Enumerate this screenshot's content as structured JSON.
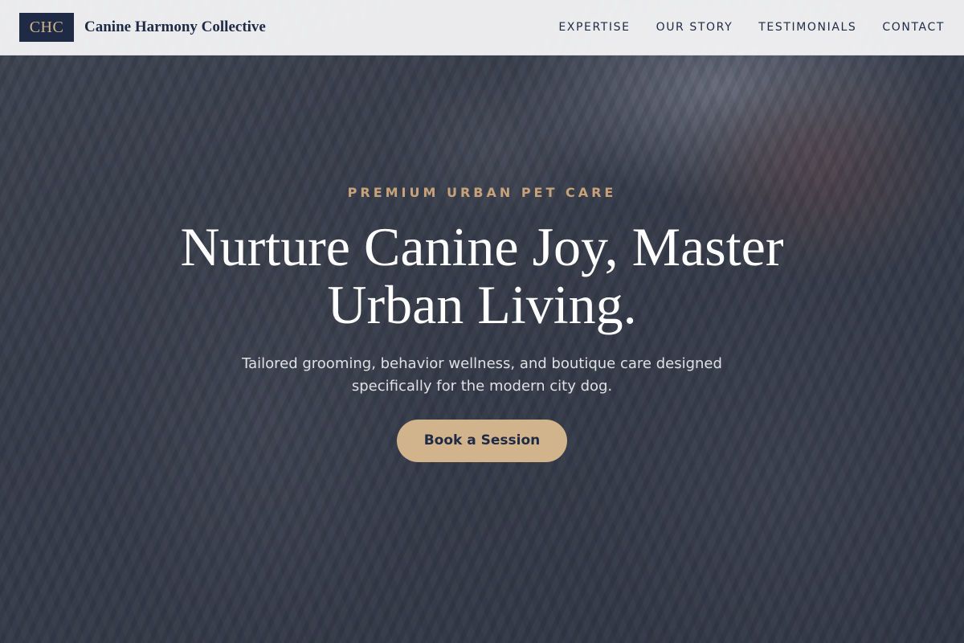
{
  "header": {
    "logo_text": "CHC",
    "brand_name": "Canine Harmony Collective",
    "nav": [
      {
        "label": "EXPERTISE"
      },
      {
        "label": "OUR STORY"
      },
      {
        "label": "TESTIMONIALS"
      },
      {
        "label": "CONTACT"
      }
    ]
  },
  "hero": {
    "eyebrow": "PREMIUM URBAN PET CARE",
    "headline": "Nurture Canine Joy, Master Urban Living.",
    "subtitle": "Tailored grooming, behavior wellness, and boutique care designed specifically for the modern city dog.",
    "cta_label": "Book a Session"
  },
  "colors": {
    "navy": "#1f2a44",
    "accent_tan": "#d2b48c",
    "header_bg": "#f3f3f4"
  }
}
